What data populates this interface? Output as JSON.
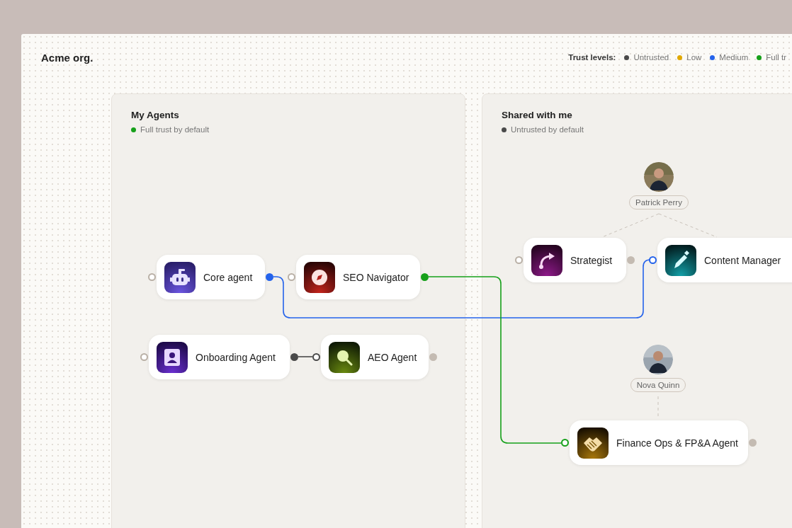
{
  "org": {
    "title": "Acme org."
  },
  "legend": {
    "label": "Trust levels:",
    "items": [
      {
        "label": "Untrusted",
        "color": "#4a4a4a"
      },
      {
        "label": "Low",
        "color": "#e0a800"
      },
      {
        "label": "Medium",
        "color": "#2563eb"
      },
      {
        "label": "Full tr",
        "color": "#16a01a"
      }
    ]
  },
  "panels": [
    {
      "title": "My Agents",
      "subtitle": "Full trust by default",
      "color": "#16a01a"
    },
    {
      "title": "Shared with me",
      "subtitle": "Untrusted by default",
      "color": "#4a4a4a"
    }
  ],
  "owners": [
    {
      "name": "Patrick Perry"
    },
    {
      "name": "Nova Quinn"
    }
  ],
  "agents": [
    {
      "name": "Core agent",
      "in_port": {
        "filled": false,
        "color": "#b9b0a6"
      },
      "out_port": {
        "filled": true,
        "color": "#2563eb"
      }
    },
    {
      "name": "SEO Navigator",
      "in_port": {
        "filled": false,
        "color": "#b9b0a6"
      },
      "out_port": {
        "filled": true,
        "color": "#16a01a"
      }
    },
    {
      "name": "Onboarding Agent",
      "in_port": {
        "filled": false,
        "color": "#b9b0a6"
      },
      "out_port": {
        "filled": true,
        "color": "#4a4a4a"
      }
    },
    {
      "name": "AEO Agent",
      "in_port": {
        "filled": false,
        "color": "#4a4a4a"
      },
      "out_port": {
        "filled": true,
        "color": "#c4bbb2"
      }
    },
    {
      "name": "Strategist",
      "in_port": {
        "filled": false,
        "color": "#b9b0a6"
      },
      "out_port": {
        "filled": true,
        "color": "#c4bbb2"
      }
    },
    {
      "name": "Content Manager",
      "in_port": {
        "filled": false,
        "color": "#2563eb"
      }
    },
    {
      "name": "Finance Ops & FP&A Agent",
      "in_port": {
        "filled": false,
        "color": "#16a01a"
      },
      "out_port": {
        "filled": true,
        "color": "#c4bbb2"
      }
    }
  ]
}
